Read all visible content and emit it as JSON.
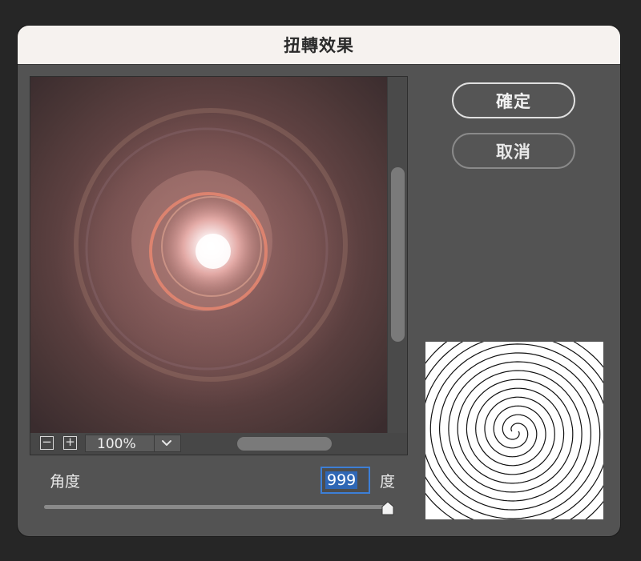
{
  "dialog": {
    "title": "扭轉效果",
    "ok_label": "確定",
    "cancel_label": "取消"
  },
  "preview": {
    "zoom_out_symbol": "−",
    "zoom_in_symbol": "+",
    "zoom_level": "100%",
    "zoom_dropdown_icon": "chevron-down-icon"
  },
  "angle": {
    "label": "角度",
    "value": "999",
    "unit": "度",
    "slider_fraction": 1.0
  },
  "colors": {
    "accent": "#3d7fd6",
    "selection": "#2f67b5",
    "dialog_bg": "#535353",
    "titlebar_bg": "#f6f2ef"
  }
}
